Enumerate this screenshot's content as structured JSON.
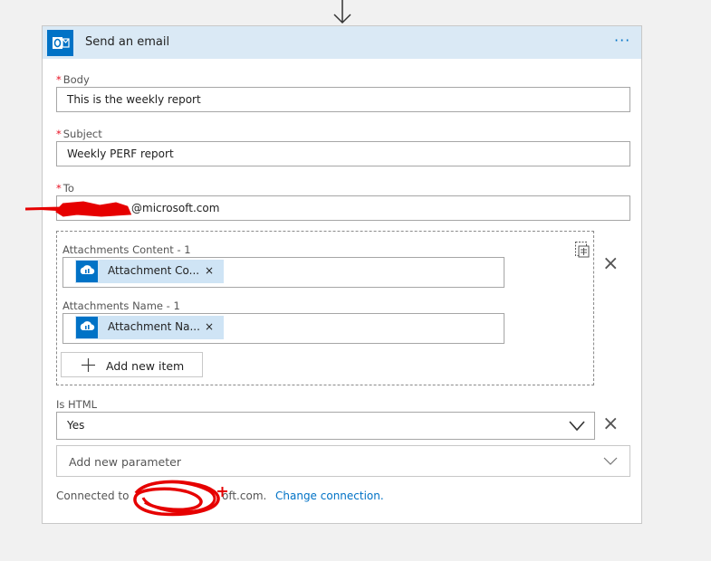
{
  "card": {
    "title": "Send an email",
    "more_label": "···"
  },
  "body_field": {
    "label": "Body",
    "value": "This is the weekly report"
  },
  "subject_field": {
    "label": "Subject",
    "value": "Weekly PERF report"
  },
  "to_field": {
    "label": "To",
    "value": "@microsoft.com"
  },
  "attachments": {
    "content_label": "Attachments Content - 1",
    "content_token": "Attachment Co...",
    "name_label": "Attachments Name - 1",
    "name_token": "Attachment Na...",
    "add_item_label": "Add new item",
    "token_close": "×"
  },
  "is_html": {
    "label": "Is HTML",
    "value": "Yes"
  },
  "add_parameter": {
    "placeholder": "Add new parameter"
  },
  "connection": {
    "connected_to": "Connected to",
    "account_suffix": "oft.com.",
    "change_label": "Change connection."
  },
  "colors": {
    "accent": "#0072c6",
    "header_bg": "#dae9f5",
    "token_bg": "#cfe4f5",
    "required": "#e81123",
    "redaction": "#e60000"
  }
}
